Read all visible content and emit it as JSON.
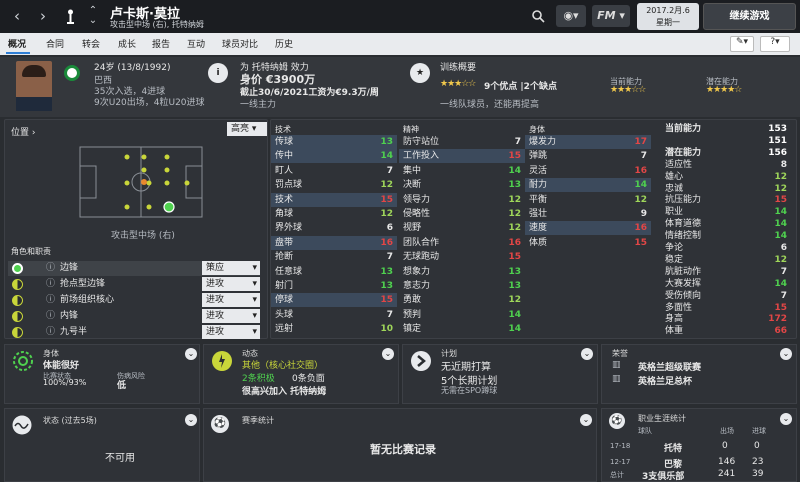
{
  "topbar": {
    "back_icon": "‹",
    "forward_icon": "›",
    "player_name": "卢卡斯·莫拉",
    "player_sub": "攻击型中场 (右), 托特纳姆",
    "date_line1": "2017.2月.6",
    "date_line2": "星期一",
    "continue_label": "继续游戏"
  },
  "tabs": [
    "概况",
    "合同",
    "转会",
    "成长",
    "报告",
    "互动",
    "球员对比",
    "历史"
  ],
  "header": {
    "age_line": "24岁 (13/8/1992)",
    "nation": "巴西",
    "caps_line": "35次入选，4进球",
    "u20_line": "9次U20出场，4粒U20进球",
    "club_line": "为 托特纳姆 效力",
    "value_line": "身价 €3900万",
    "contract_line": "截止30/6/2021工资为€9.3万/周",
    "squad_line": "一线主力",
    "training_title": "训练概要",
    "training_stars": "★★★☆☆",
    "training_points": "9个优点 |2个缺点",
    "training_desc": "一线队球员，还能再提高",
    "current_ability_label": "当前能力",
    "potential_ability_label": "潜在能力",
    "ca_stars": "★★★☆☆",
    "pa_stars": "★★★★☆"
  },
  "position": {
    "title": "位置 ›",
    "dropdown": "高亮",
    "label": "攻击型中场 (右)"
  },
  "roles": {
    "title": "角色和职责",
    "items": [
      {
        "name": "边锋",
        "duty": "策应"
      },
      {
        "name": "抢点型边锋",
        "duty": "进攻"
      },
      {
        "name": "前场组织核心",
        "duty": "进攻"
      },
      {
        "name": "内锋",
        "duty": "进攻"
      },
      {
        "name": "九号半",
        "duty": "进攻"
      }
    ]
  },
  "technical": {
    "title": "技术",
    "rows": [
      {
        "name": "传球",
        "value": "13"
      },
      {
        "name": "传中",
        "value": "14"
      },
      {
        "name": "盯人",
        "value": "7"
      },
      {
        "name": "罚点球",
        "value": "12"
      },
      {
        "name": "技术",
        "value": "15"
      },
      {
        "name": "角球",
        "value": "12"
      },
      {
        "name": "界外球",
        "value": "6"
      },
      {
        "name": "盘带",
        "value": "16"
      },
      {
        "name": "抢断",
        "value": "7"
      },
      {
        "name": "任意球",
        "value": "13"
      },
      {
        "name": "射门",
        "value": "13"
      },
      {
        "name": "停球",
        "value": "15"
      },
      {
        "name": "头球",
        "value": "7"
      },
      {
        "name": "远射",
        "value": "10"
      }
    ]
  },
  "mental": {
    "title": "精神",
    "rows": [
      {
        "name": "防守站位",
        "value": "7"
      },
      {
        "name": "工作投入",
        "value": "15"
      },
      {
        "name": "集中",
        "value": "14"
      },
      {
        "name": "决断",
        "value": "13"
      },
      {
        "name": "领导力",
        "value": "12"
      },
      {
        "name": "侵略性",
        "value": "12"
      },
      {
        "name": "视野",
        "value": "12"
      },
      {
        "name": "团队合作",
        "value": "16"
      },
      {
        "name": "无球跑动",
        "value": "15"
      },
      {
        "name": "想象力",
        "value": "13"
      },
      {
        "name": "意志力",
        "value": "13"
      },
      {
        "name": "勇敢",
        "value": "12"
      },
      {
        "name": "预判",
        "value": "14"
      },
      {
        "name": "镇定",
        "value": "14"
      }
    ]
  },
  "physical": {
    "title": "身体",
    "rows": [
      {
        "name": "爆发力",
        "value": "17"
      },
      {
        "name": "弹跳",
        "value": "7"
      },
      {
        "name": "灵活",
        "value": "16"
      },
      {
        "name": "耐力",
        "value": "14"
      },
      {
        "name": "平衡",
        "value": "12"
      },
      {
        "name": "强壮",
        "value": "9"
      },
      {
        "name": "速度",
        "value": "16"
      },
      {
        "name": "体质",
        "value": "15"
      }
    ]
  },
  "side": {
    "title": "当前能力",
    "rows": [
      {
        "name": "当前能力",
        "value": "153"
      },
      {
        "name": "",
        "value": "151"
      },
      {
        "name": "潜在能力",
        "value": "156"
      },
      {
        "name": "适应性",
        "value": "8"
      },
      {
        "name": "雄心",
        "value": "12"
      },
      {
        "name": "忠诚",
        "value": "12"
      },
      {
        "name": "抗压能力",
        "value": "15"
      },
      {
        "name": "职业",
        "value": "14"
      },
      {
        "name": "体育道德",
        "value": "14"
      },
      {
        "name": "情绪控制",
        "value": "14"
      },
      {
        "name": "争论",
        "value": "6"
      },
      {
        "name": "稳定",
        "value": "12"
      },
      {
        "name": "肮脏动作",
        "value": "7"
      },
      {
        "name": "大赛发挥",
        "value": "14"
      },
      {
        "name": "受伤倾向",
        "value": "7"
      },
      {
        "name": "多面性",
        "value": "15"
      },
      {
        "name": "身高",
        "value": "172"
      },
      {
        "name": "体重",
        "value": "66"
      }
    ]
  },
  "cards": {
    "body_title": "身体",
    "body_status": "体能很好",
    "body_cond_label": "比赛状态",
    "body_cond_value": "100%/93%",
    "body_risk_label": "伤病风险",
    "body_risk_value": "低",
    "mood_title": "动态",
    "mood_value": "其他（核心社交圈）",
    "mood_pos": "2条积极",
    "mood_neg": "0条负面",
    "mood_desc": "很高兴加入 托特纳姆",
    "plan_title": "计划",
    "plan_value": "无近期打算",
    "plan_long": "5个长期计划",
    "plan_desc": "无需在SPO蹲球",
    "honors_title": "荣誉",
    "honor1": "英格兰超级联赛",
    "honor2": "英格兰足总杯",
    "form_title": "状态 (过去5场)",
    "form_value": "不可用",
    "season_title": "赛季统计",
    "season_value": "暂无比赛记录",
    "career_title": "职业生涯统计",
    "career_headers": [
      "球队",
      "出场",
      "进球"
    ],
    "career_rows": [
      {
        "season": "17-18",
        "team": "托特",
        "apps": "0",
        "goals": "0"
      },
      {
        "season": "12-17",
        "team": "巴黎",
        "apps": "146",
        "goals": "23"
      },
      {
        "season": "总计",
        "team": "3支俱乐部",
        "apps": "241",
        "goals": "39"
      }
    ]
  }
}
